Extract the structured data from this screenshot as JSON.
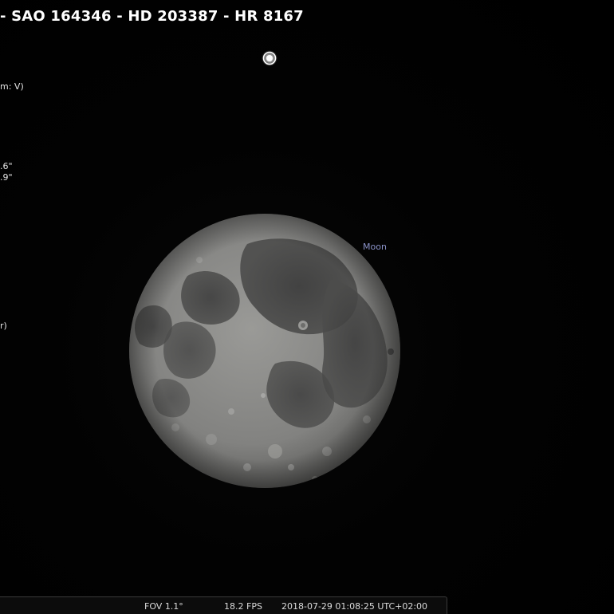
{
  "object_info": {
    "title": "- SAO 164346 - HD 203387 - HR 8167",
    "lines": [
      "m: V)",
      ".6\"",
      ".9\"",
      "r)"
    ]
  },
  "moon": {
    "label": "Moon"
  },
  "status_bar": {
    "fov": "FOV 1.1°",
    "fps": "18.2 FPS",
    "datetime": "2018-07-29 01:08:25 UTC+02:00"
  },
  "colors": {
    "background": "#000000",
    "label_blue": "#8b93c9",
    "moon_base": "#8a8a88"
  },
  "icons": {
    "selected_star": "star-marker-icon"
  }
}
